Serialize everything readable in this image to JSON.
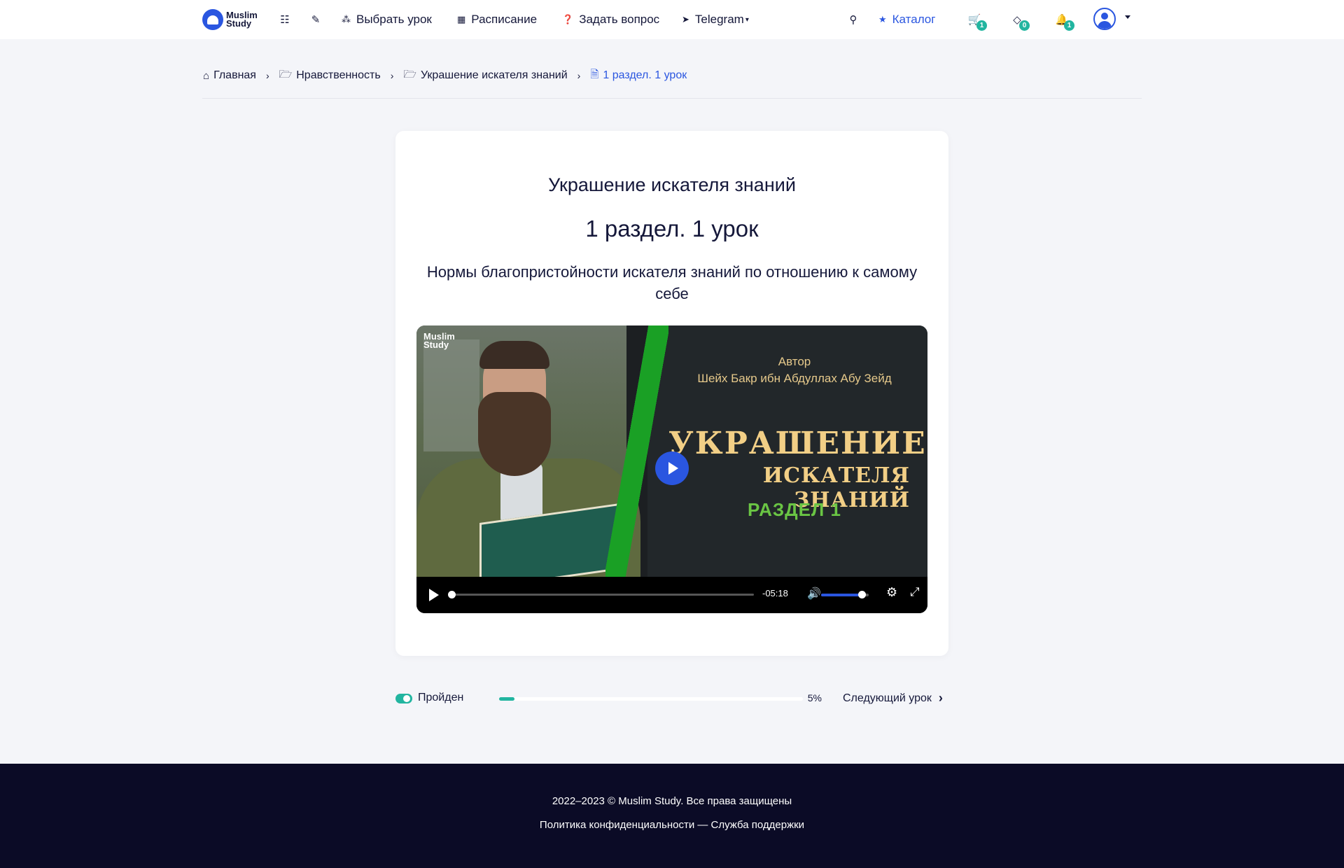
{
  "header": {
    "logo_line1": "Muslim",
    "logo_line2": "Study",
    "nav": {
      "choose_lesson": "Выбрать урок",
      "schedule": "Расписание",
      "ask_question": "Задать вопрос",
      "telegram": "Telegram"
    },
    "catalog": "Каталог",
    "badges": {
      "cart": "1",
      "diamond": "0",
      "bell": "1"
    }
  },
  "breadcrumb": {
    "home": "Главная",
    "category": "Нравственность",
    "course": "Украшение искателя знаний",
    "current": "1 раздел. 1 урок"
  },
  "lesson": {
    "course_title": "Украшение искателя знаний",
    "title": "1 раздел. 1 урок",
    "subtitle": "Нормы благопристойности искателя знаний по отношению к самому себе"
  },
  "video": {
    "watermark_line1": "Muslim",
    "watermark_line2": "Study",
    "author_label": "Автор",
    "author_name": "Шейх Бакр ибн Абдуллах Абу Зейд",
    "title_line1": "УКРАШЕНИЕ",
    "title_line2": "ИСКАТЕЛЯ ЗНАНИЙ",
    "section": "РАЗДЕЛ 1",
    "time_remaining": "-05:18",
    "playback_progress": 0.0,
    "volume": 0.85
  },
  "progress": {
    "passed_label": "Пройден",
    "percent_label": "5%",
    "percent_value": 5,
    "next_label": "Следующий урок"
  },
  "footer": {
    "copyright": "2022–2023 © Muslim Study. Все права защищены",
    "links": "Политика конфиденциальности — Служба поддержки"
  },
  "colors": {
    "accent": "#2a56e0",
    "teal": "#22b5a0",
    "footer_bg": "#0b0b26",
    "page_bg": "#f4f5f9"
  }
}
